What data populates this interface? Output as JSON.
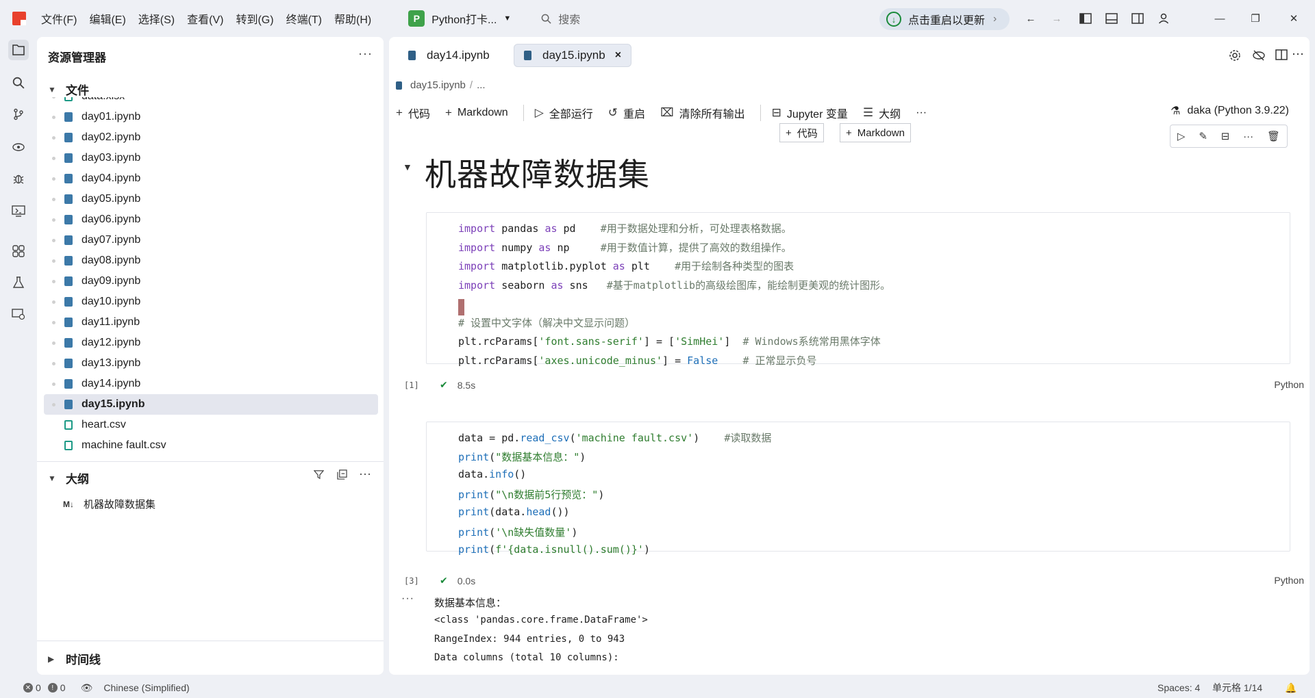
{
  "titlebar": {
    "menus": [
      "文件(F)",
      "编辑(E)",
      "选择(S)",
      "查看(V)",
      "转到(G)",
      "终端(T)",
      "帮助(H)"
    ],
    "profile_badge": "P",
    "profile_label": "Python打卡...",
    "search_placeholder": "搜索",
    "update_label": "点击重启以更新"
  },
  "sidebar": {
    "title": "资源管理器",
    "files_section": "文件",
    "files": [
      {
        "name": "data.xlsx",
        "type": "xlsx"
      },
      {
        "name": "day01.ipynb",
        "type": "ipynb"
      },
      {
        "name": "day02.ipynb",
        "type": "ipynb"
      },
      {
        "name": "day03.ipynb",
        "type": "ipynb"
      },
      {
        "name": "day04.ipynb",
        "type": "ipynb"
      },
      {
        "name": "day05.ipynb",
        "type": "ipynb"
      },
      {
        "name": "day06.ipynb",
        "type": "ipynb"
      },
      {
        "name": "day07.ipynb",
        "type": "ipynb"
      },
      {
        "name": "day08.ipynb",
        "type": "ipynb"
      },
      {
        "name": "day09.ipynb",
        "type": "ipynb"
      },
      {
        "name": "day10.ipynb",
        "type": "ipynb"
      },
      {
        "name": "day11.ipynb",
        "type": "ipynb"
      },
      {
        "name": "day12.ipynb",
        "type": "ipynb"
      },
      {
        "name": "day13.ipynb",
        "type": "ipynb"
      },
      {
        "name": "day14.ipynb",
        "type": "ipynb"
      },
      {
        "name": "day15.ipynb",
        "type": "ipynb",
        "selected": true
      },
      {
        "name": "heart.csv",
        "type": "csv"
      },
      {
        "name": "machine fault.csv",
        "type": "csv"
      }
    ],
    "outline_section": "大纲",
    "outline_items": [
      {
        "badge": "M↓",
        "label": "机器故障数据集"
      }
    ],
    "timeline_section": "时间线"
  },
  "editor": {
    "tabs": [
      {
        "label": "day14.ipynb",
        "active": false
      },
      {
        "label": "day15.ipynb",
        "active": true,
        "close": "×"
      }
    ],
    "breadcrumb": {
      "file": "day15.ipynb",
      "rest": "..."
    },
    "toolbar": {
      "code": "代码",
      "markdown": "Markdown",
      "run_all": "全部运行",
      "restart": "重启",
      "clear_outputs": "清除所有输出",
      "jupyter_vars": "Jupyter 变量",
      "outline": "大纲",
      "more": "···"
    },
    "kernel": "daka (Python 3.9.22)",
    "insert_bar": {
      "code": "代码",
      "markdown": "Markdown"
    },
    "heading": "机器故障数据集",
    "cells": [
      {
        "count": "[1]",
        "time": "8.5s",
        "lang": "Python"
      },
      {
        "count": "[3]",
        "time": "0.0s",
        "lang": "Python"
      }
    ],
    "output_lines": [
      "数据基本信息：",
      "<class 'pandas.core.frame.DataFrame'>",
      "RangeIndex: 944 entries, 0 to 943",
      "Data columns (total 10 columns):"
    ]
  },
  "statusbar": {
    "errors": "0",
    "warnings": "0",
    "language": "Chinese (Simplified)",
    "spaces": "Spaces: 4",
    "cell_pos": "单元格 1/14"
  }
}
